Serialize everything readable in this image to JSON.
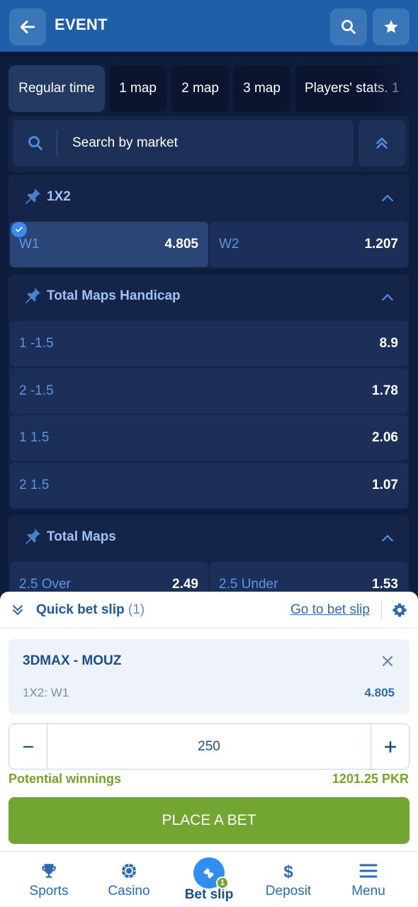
{
  "header": {
    "title": "EVENT"
  },
  "tabs": [
    {
      "label": "Regular time",
      "active": true
    },
    {
      "label": "1 map"
    },
    {
      "label": "2 map"
    },
    {
      "label": "3 map"
    },
    {
      "label": "Players' stats. 1"
    }
  ],
  "search": {
    "placeholder": "Search by market"
  },
  "markets": [
    {
      "title": "1X2",
      "odds": [
        {
          "label": "W1",
          "value": "4.805",
          "selected": true
        },
        {
          "label": "W2",
          "value": "1.207"
        }
      ]
    },
    {
      "title": "Total Maps Handicap",
      "odds": [
        {
          "label": "1 -1.5",
          "value": "8.9"
        },
        {
          "label": "2 -1.5",
          "value": "1.78"
        },
        {
          "label": "1 1.5",
          "value": "2.06"
        },
        {
          "label": "2 1.5",
          "value": "1.07"
        }
      ]
    },
    {
      "title": "Total Maps",
      "odds": [
        {
          "label": "2.5 Over",
          "value": "2.49"
        },
        {
          "label": "2.5 Under",
          "value": "1.53"
        }
      ]
    }
  ],
  "bet_slip": {
    "title": "Quick bet slip",
    "count": "(1)",
    "go_link": "Go to bet slip",
    "event": "3DMAX - MOUZ",
    "market": "1X2: W1",
    "odd": "4.805",
    "stake": "250",
    "potential_label": "Potential winnings",
    "potential_value": "1201.25 PKR",
    "place_label": "PLACE A BET"
  },
  "nav": [
    {
      "label": "Sports",
      "icon": "trophy-icon"
    },
    {
      "label": "Casino",
      "icon": "casino-chip-icon"
    },
    {
      "label": "Bet slip",
      "icon": "ticket-icon",
      "active": true,
      "badge": "1"
    },
    {
      "label": "Deposit",
      "icon": "dollar-icon"
    },
    {
      "label": "Menu",
      "icon": "menu-icon"
    }
  ],
  "colors": {
    "header": "#1f5ea8",
    "accent": "#2f8ff0",
    "place_button": "#73a533",
    "odd_label": "#5b95e4"
  }
}
